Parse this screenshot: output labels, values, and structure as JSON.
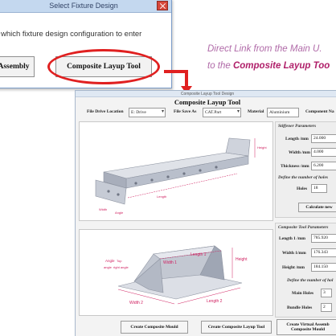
{
  "dialog": {
    "title": "Select Fixture Design",
    "prompt": "which fixture design configuration to enter",
    "assembly_button": "Assembly",
    "composite_button": "Composite Layup Tool"
  },
  "annotation": {
    "line1": "Direct Link from the Main U.",
    "line2_prefix": "to the ",
    "line2_highlight": "Composite Layup Too"
  },
  "main_window": {
    "title": "Composite Layup Tool Design",
    "heading": "Composite Layup Tool",
    "file_drive_label": "File Drive Location",
    "file_drive_value": "E: Drive",
    "file_save_label": "File Save As",
    "file_save_value": "CAT.Part",
    "material_label": "Material",
    "material_value": "Aluminium",
    "component_label": "Component Na"
  },
  "stiffener": {
    "title": "Stiffener Parameters",
    "length_label": "Length /mm",
    "length_value": "24.000",
    "width_label": "Width /mm",
    "width_value": "4.000",
    "thickness_label": "Thickness /mm",
    "thickness_value": "6.200",
    "holes_title": "Define the number of holes",
    "holes_label": "Holes",
    "holes_value": "18",
    "calc_button": "Calculate new"
  },
  "tool": {
    "title": "Composite Tool Parameters",
    "length_label": "Length 1 /mm",
    "length_value": "785.920",
    "width_label": "Width 1/mm",
    "width_value": "176.343",
    "height_label": "Height /mm",
    "height_value": "184.150",
    "holes_title": "Define the number of hol",
    "main_holes_label": "Main Holes",
    "main_holes_value": "3",
    "bundle_holes_label": "Bundle Holes",
    "bundle_holes_value": "2"
  },
  "diagram1": {
    "labels": {
      "length": "Length",
      "height": "Height",
      "width": "Width",
      "angle": "Angle"
    }
  },
  "diagram2": {
    "labels": {
      "width1": "Width 1",
      "length1": "Length 1",
      "height": "Height",
      "width2": "Width 2",
      "length2": "Length 2",
      "angle": "Angle",
      "top": "Top",
      "angle_left": "angle",
      "angle_right": "right angle"
    }
  },
  "buttons": {
    "create_mould": "Create Composite Mould",
    "create_tool": "Create Composite Layup Tool",
    "create_virtual_1": "Create Virtual Assemb",
    "create_virtual_2": "Composite Mould"
  },
  "colors": {
    "highlight_red": "#e02020",
    "annotation_purple": "#b06aa8",
    "annotation_magenta": "#b0206a",
    "title_bar_blue": "#c4d8ef"
  }
}
